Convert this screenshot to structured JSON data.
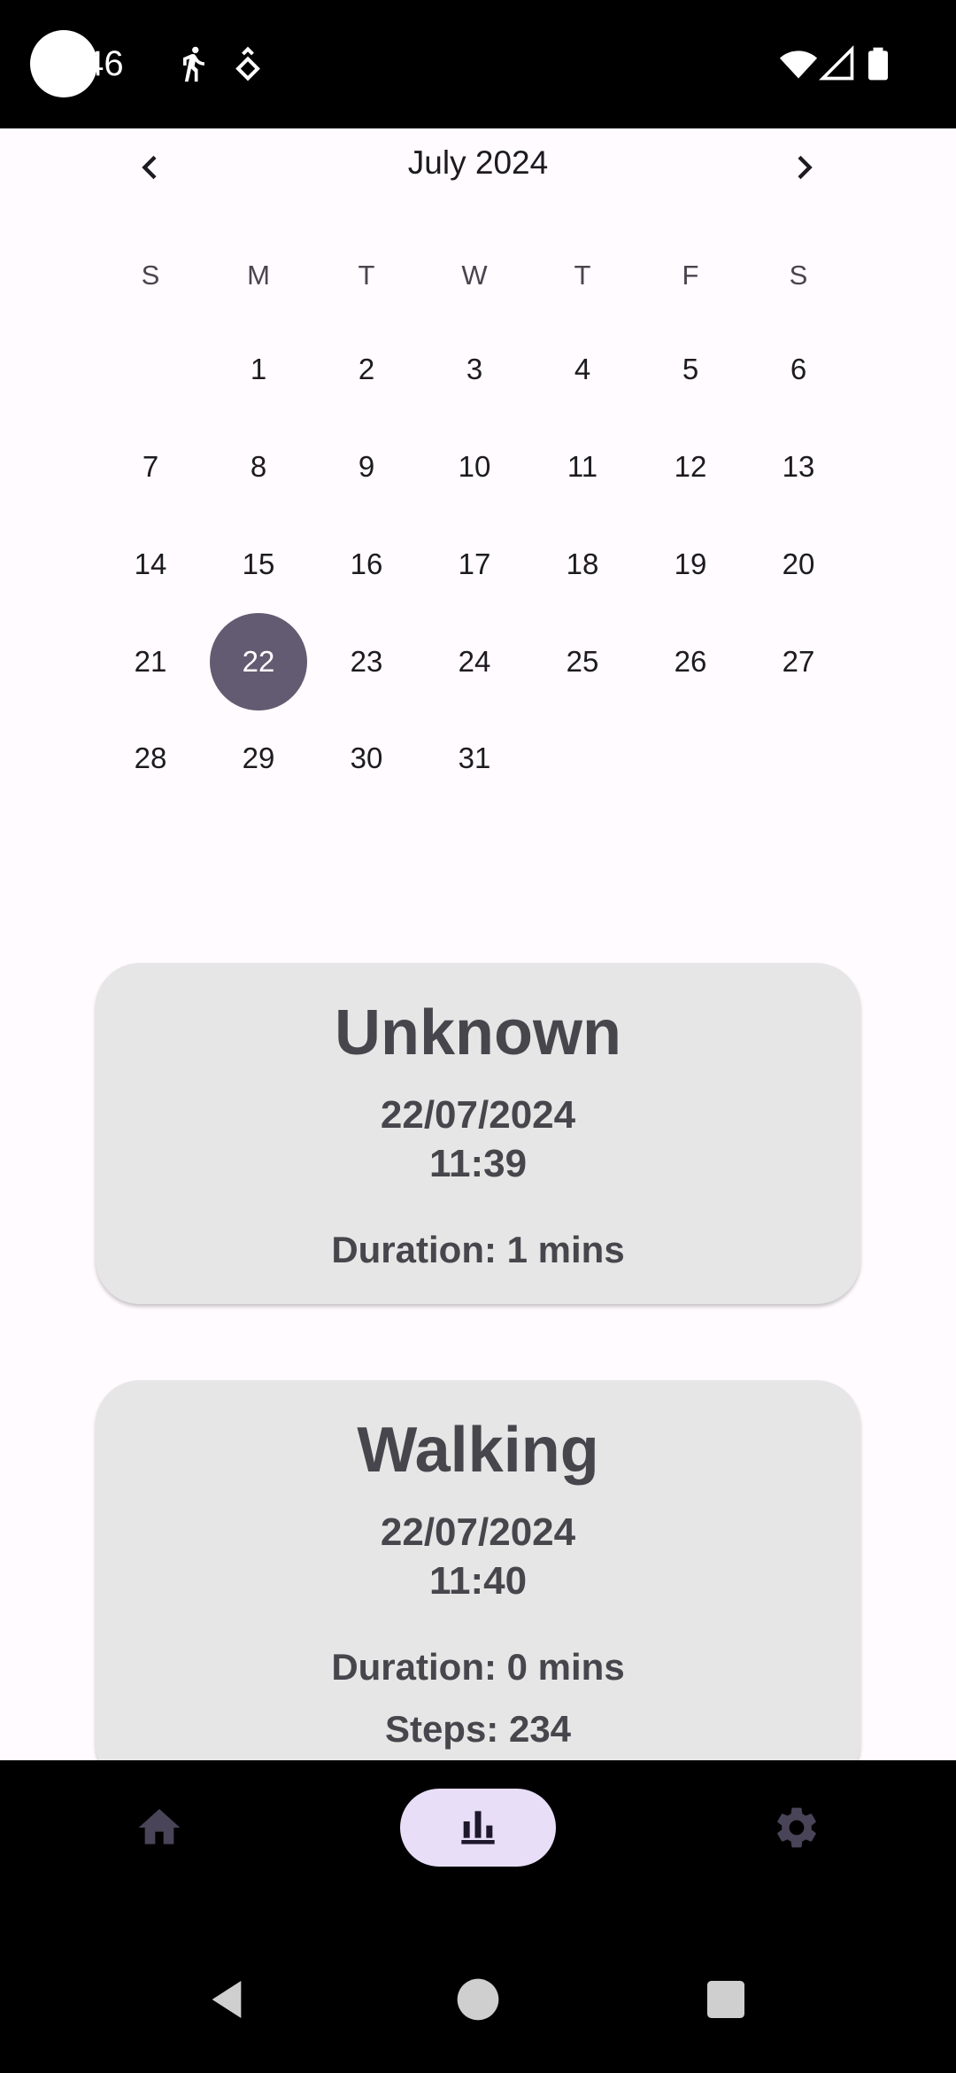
{
  "status_bar": {
    "time": ":46",
    "icons": [
      "running-icon",
      "fitness-icon",
      "wifi-icon",
      "signal-icon",
      "battery-icon"
    ]
  },
  "calendar": {
    "month_label": "July 2024",
    "prev_icon": "chevron-left-icon",
    "next_icon": "chevron-right-icon",
    "weekdays": [
      "S",
      "M",
      "T",
      "W",
      "T",
      "F",
      "S"
    ],
    "weeks": [
      [
        "",
        "1",
        "2",
        "3",
        "4",
        "5",
        "6"
      ],
      [
        "7",
        "8",
        "9",
        "10",
        "11",
        "12",
        "13"
      ],
      [
        "14",
        "15",
        "16",
        "17",
        "18",
        "19",
        "20"
      ],
      [
        "21",
        "22",
        "23",
        "24",
        "25",
        "26",
        "27"
      ],
      [
        "28",
        "29",
        "30",
        "31",
        "",
        "",
        ""
      ]
    ],
    "selected_day": "22",
    "selected_color": "#625b71"
  },
  "activities": [
    {
      "title": "Unknown",
      "date": "22/07/2024",
      "time": "11:39",
      "duration": "Duration: 1 mins"
    },
    {
      "title": "Walking",
      "date": "22/07/2024",
      "time": "11:40",
      "duration": "Duration: 0 mins",
      "steps": "Steps: 234"
    }
  ],
  "bottom_nav": {
    "items": [
      {
        "icon": "home-icon",
        "active": false
      },
      {
        "icon": "bar-chart-icon",
        "active": true
      },
      {
        "icon": "settings-gear-icon",
        "active": false
      }
    ],
    "active_pill_color": "#e8def8"
  },
  "system_nav": {
    "icons": [
      "back-triangle-icon",
      "home-circle-icon",
      "recents-square-icon"
    ]
  }
}
